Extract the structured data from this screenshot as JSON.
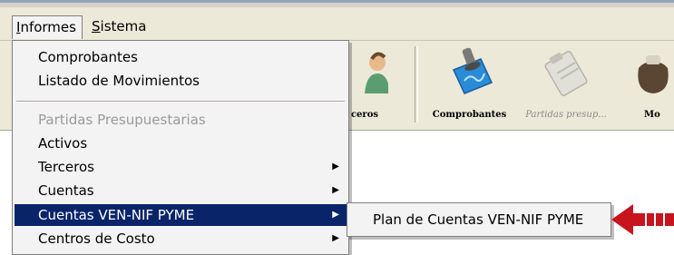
{
  "menubar": {
    "items": [
      {
        "label": "Informes"
      },
      {
        "label": "Sistema"
      }
    ]
  },
  "toolbar": {
    "buttons": [
      {
        "label": "ceros",
        "icon": "people-icon",
        "enabled": true
      },
      {
        "label": "Comprobantes",
        "icon": "stamp-document-icon",
        "enabled": true
      },
      {
        "label": "Partidas presup...",
        "icon": "clipboard-icon",
        "enabled": false
      },
      {
        "label": "Mo",
        "icon": "money-bag-icon",
        "enabled": true
      }
    ]
  },
  "dropdown": {
    "items": [
      {
        "label": "Comprobantes"
      },
      {
        "label": "Listado de Movimientos"
      },
      {
        "label": "Partidas Presupuestarias",
        "enabled": false
      },
      {
        "label": "Activos"
      },
      {
        "label": "Terceros",
        "submenu": true
      },
      {
        "label": "Cuentas",
        "submenu": true
      },
      {
        "label": "Cuentas VEN-NIF PYME",
        "submenu": true,
        "selected": true
      },
      {
        "label": "Centros de Costo",
        "submenu": true
      }
    ]
  },
  "submenu": {
    "items": [
      {
        "label": "Plan de Cuentas VEN-NIF PYME"
      }
    ]
  },
  "colors": {
    "menu_highlight": "#0a246a",
    "annotation_arrow": "#c8141c"
  }
}
